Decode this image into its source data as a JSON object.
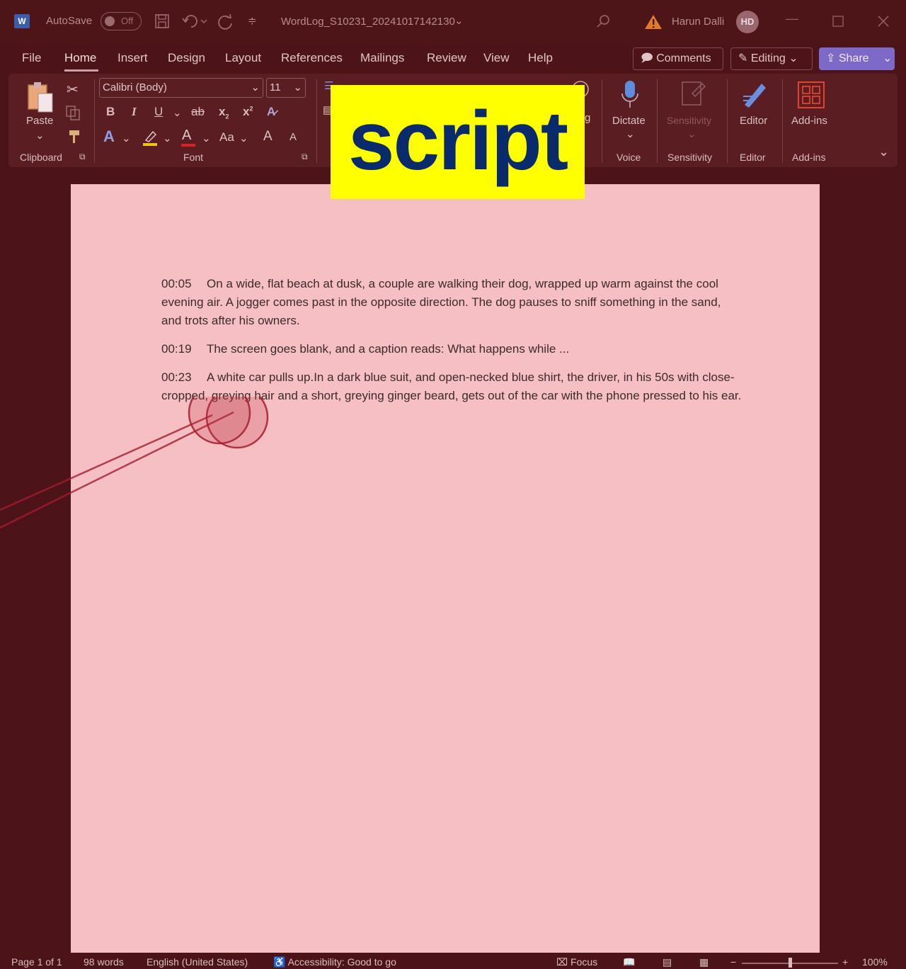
{
  "titlebar": {
    "autosave_label": "AutoSave",
    "autosave_state": "Off",
    "filename": "WordLog_S10231_20241017142130",
    "user_name": "Harun Dalli",
    "user_initials": "HD"
  },
  "tabs": [
    "File",
    "Home",
    "Insert",
    "Design",
    "Layout",
    "References",
    "Mailings",
    "Review",
    "View",
    "Help"
  ],
  "actions": {
    "comments": "Comments",
    "editing": "Editing",
    "share": "Share"
  },
  "ribbon": {
    "paste": "Paste",
    "font_name": "Calibri (Body)",
    "font_size": "11",
    "dictate": "Dictate",
    "sensitivity": "Sensitivity",
    "editor": "Editor",
    "addins": "Add-ins",
    "groups": {
      "clipboard": "Clipboard",
      "font": "Font",
      "voice": "Voice",
      "sensitivity": "Sensitivity",
      "editor": "Editor",
      "addins": "Add-ins"
    },
    "format_buttons": {
      "bold": "B",
      "italic": "I",
      "underline": "U",
      "strike": "ab",
      "subscript": "x",
      "superscript": "x",
      "change_case": "Aa",
      "grow": "A",
      "shrink": "A"
    }
  },
  "overlay_label": "script",
  "document": {
    "paragraphs": [
      {
        "time": "00:05",
        "text": "On a wide, flat beach at dusk, a couple are walking their dog, wrapped up warm against the cool evening air. A jogger comes past in the opposite direction. The dog pauses to sniff something in the sand, and trots after his owners."
      },
      {
        "time": "00:19",
        "text": "The screen goes blank, and a caption reads: What happens while ..."
      },
      {
        "time": "00:23",
        "text": "A white car pulls up.In a dark blue suit, and open-necked blue shirt, the driver, in his 50s with close-cropped, greying hair and a short, greying ginger beard, gets out of the car with the phone pressed to his ear."
      }
    ]
  },
  "statusbar": {
    "page": "Page 1 of 1",
    "words": "98 words",
    "language": "English (United States)",
    "accessibility": "Accessibility: Good to go",
    "focus": "Focus",
    "zoom": "100%"
  },
  "colors": {
    "chrome": "#4c1418",
    "ribbon": "#5a1e22",
    "page": "#f6bfc3",
    "share": "#7d69c7",
    "overlay_bg": "#ffff00",
    "overlay_text": "#0a2a6e",
    "gaze": "#b01a28"
  }
}
